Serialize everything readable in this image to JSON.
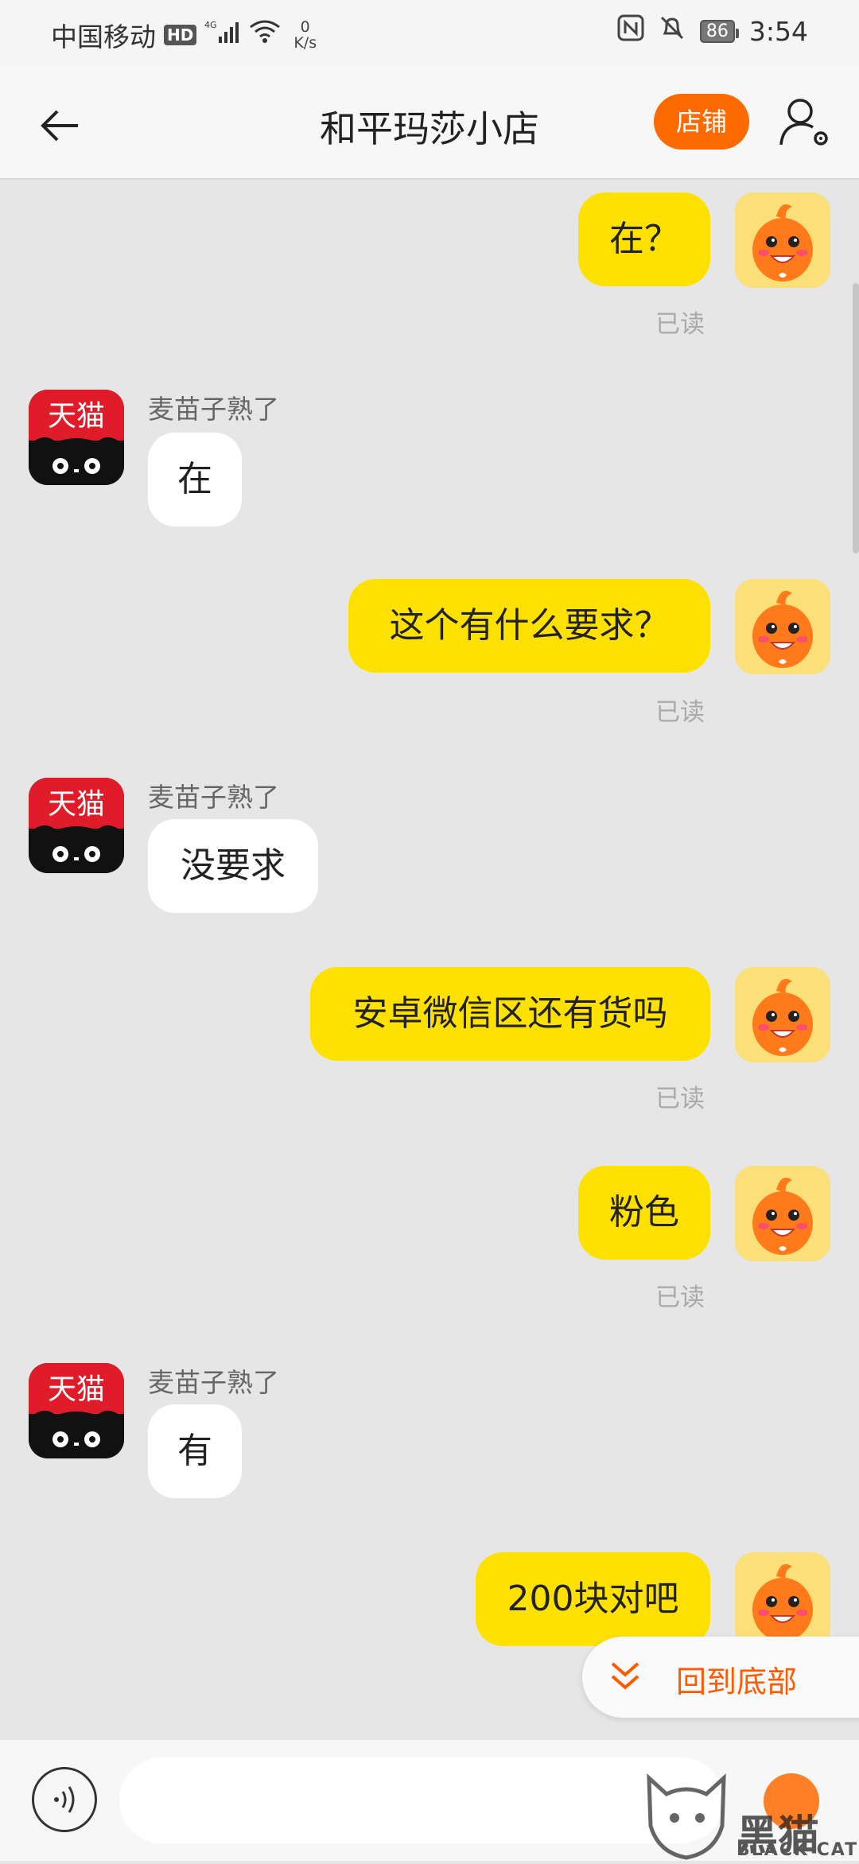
{
  "status_bar": {
    "carrier": "中国移动",
    "hd": "HD",
    "network": "4G",
    "speed_value": "0",
    "speed_unit": "K/s",
    "battery": "86",
    "time": "3:54"
  },
  "header": {
    "title": "和平玛莎小店",
    "shop_button": "店铺"
  },
  "messages": [
    {
      "side": "right",
      "text": "在？",
      "status": "已读"
    },
    {
      "side": "left",
      "sender": "麦苗子熟了",
      "text": "在"
    },
    {
      "side": "right",
      "text": "这个有什么要求？",
      "status": "已读"
    },
    {
      "side": "left",
      "sender": "麦苗子熟了",
      "text": "没要求"
    },
    {
      "side": "right",
      "text": "安卓微信区还有货吗",
      "status": "已读"
    },
    {
      "side": "right",
      "text": "粉色",
      "status": "已读"
    },
    {
      "side": "left",
      "sender": "麦苗子熟了",
      "text": "有"
    },
    {
      "side": "right",
      "text": "200块对吧"
    }
  ],
  "avatar_labels": {
    "left": "天猫"
  },
  "back_to_bottom": "回到底部",
  "input": {
    "placeholder": ""
  },
  "watermark": {
    "main": "黑猫",
    "sub": "BLACK CAT"
  },
  "colors": {
    "accent": "#ff6a00",
    "bubble_self": "#ffe100",
    "bubble_other": "#ffffff",
    "background": "#e6e6e6"
  }
}
